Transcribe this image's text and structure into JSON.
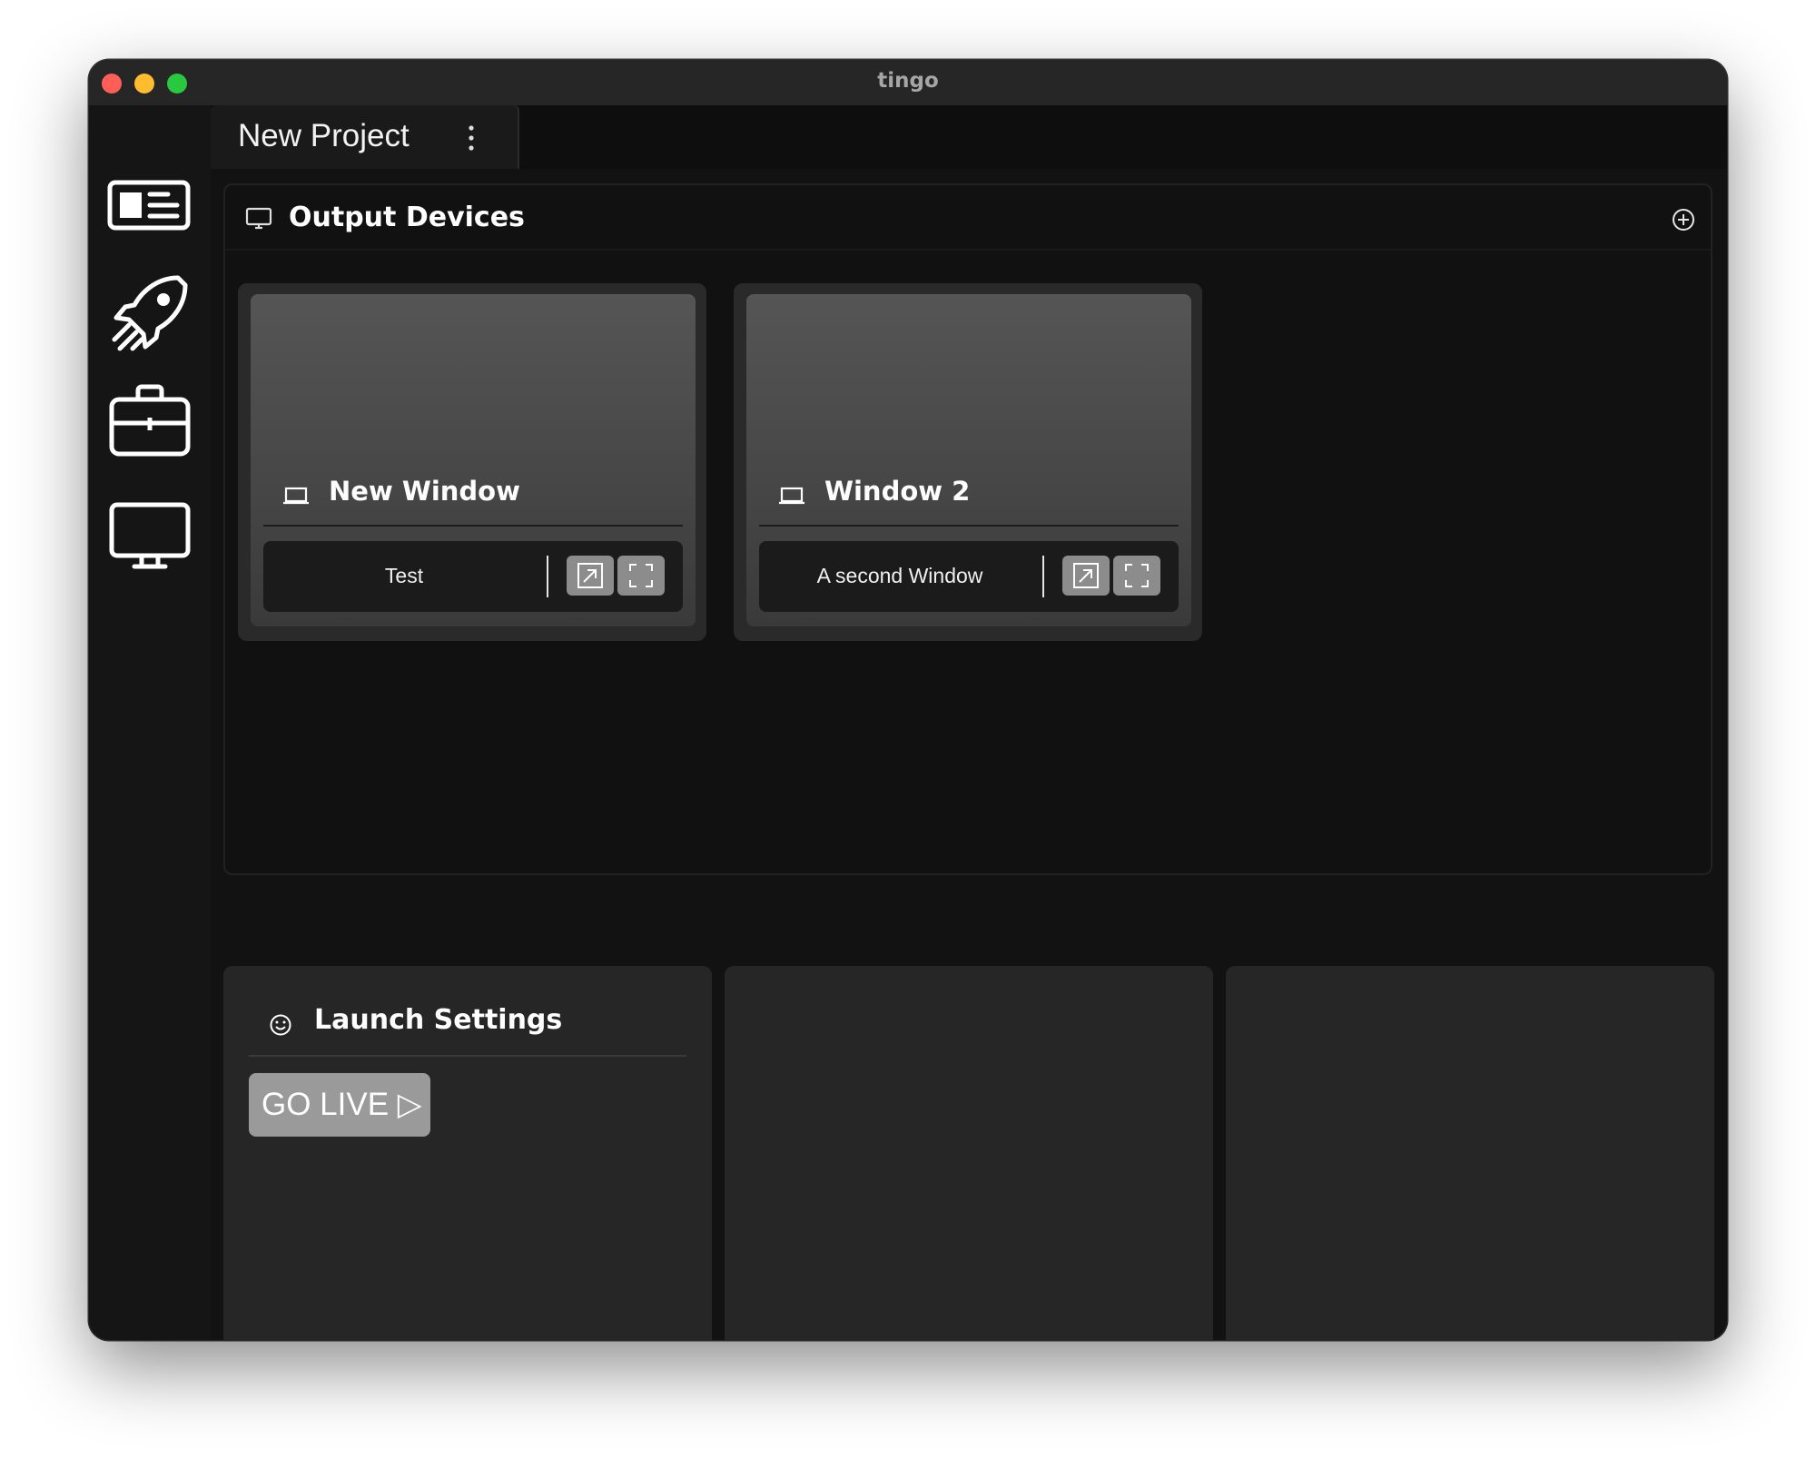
{
  "window": {
    "title": "tingo"
  },
  "sidebar": {
    "items": [
      {
        "name": "presentation",
        "icon": "presentation-card-icon"
      },
      {
        "name": "launch",
        "icon": "rocket-icon"
      },
      {
        "name": "toolbox",
        "icon": "briefcase-icon"
      },
      {
        "name": "output-devices",
        "icon": "monitor-icon"
      }
    ]
  },
  "tabs": [
    {
      "label": "New Project",
      "menu_icon": "more-vertical-icon"
    }
  ],
  "output_devices": {
    "title": "Output Devices",
    "icon": "monitor-icon",
    "add_icon": "plus-circle-icon",
    "devices": [
      {
        "name": "New Window",
        "description": "Test",
        "icon": "laptop-icon"
      },
      {
        "name": "Window 2",
        "description": "A second Window",
        "icon": "laptop-icon"
      }
    ]
  },
  "launch_settings": {
    "title": "Launch Settings",
    "icon": "smiley-icon",
    "go_live_label": "GO LIVE ▷"
  },
  "colors": {
    "window_bg": "#121212",
    "titlebar": "#262626",
    "card": "#2a2a2a",
    "button_gray": "#9a9a9a"
  }
}
